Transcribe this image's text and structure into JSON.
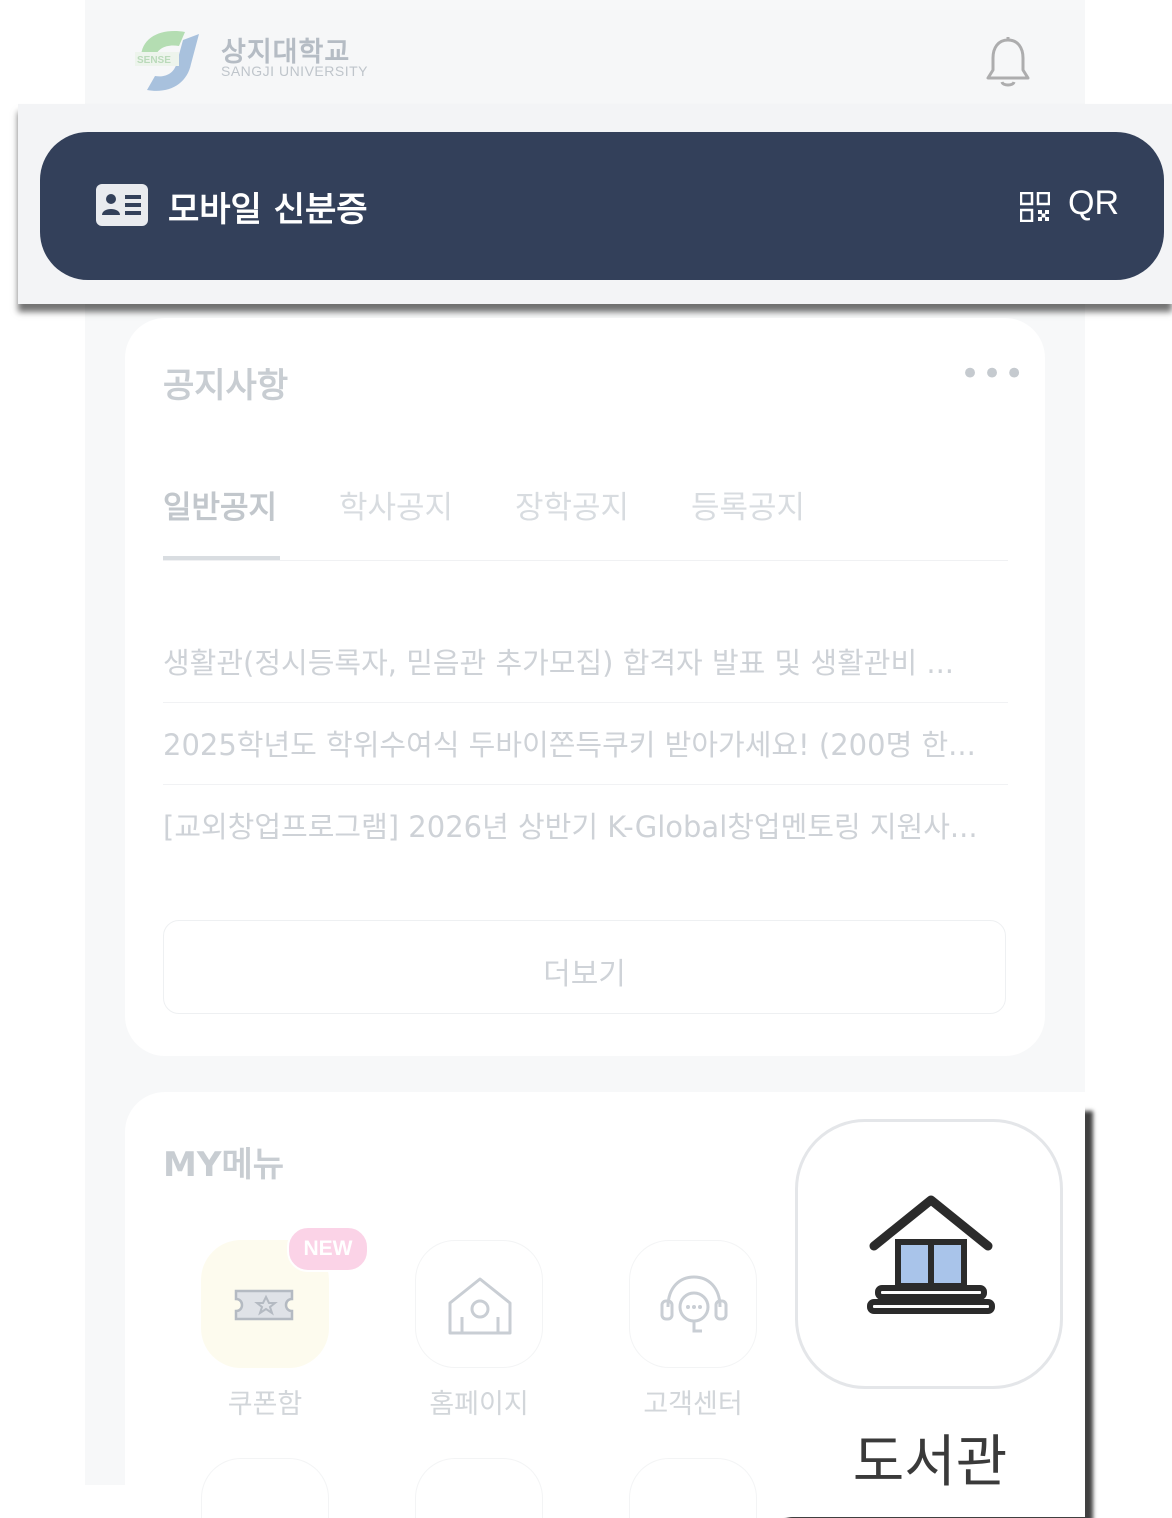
{
  "header": {
    "logo_title": "상지대학교",
    "logo_subtitle": "SANGJI UNIVERSITY",
    "logo_mark_text": "SENSE",
    "notification_icon": "bell-icon"
  },
  "id_card": {
    "label": "모바일 신분증",
    "qr_label": "QR",
    "icon": "id-card-icon",
    "qr_icon": "qr-code-icon",
    "background_color": "#33405a"
  },
  "notice": {
    "title": "공지사항",
    "more_icon": "ellipsis-icon",
    "tabs": [
      {
        "label": "일반공지",
        "active": true
      },
      {
        "label": "학사공지",
        "active": false
      },
      {
        "label": "장학공지",
        "active": false
      },
      {
        "label": "등록공지",
        "active": false
      }
    ],
    "items": [
      "생활관(정시등록자, 믿음관 추가모집) 합격자 발표 및 생활관비 ...",
      "2025학년도 학위수여식 두바이쫀득쿠키 받아가세요! (200명 한...",
      "[교외창업프로그램] 2026년 상반기 K-Global창업멘토링 지원사..."
    ],
    "more_button": "더보기"
  },
  "my_menu": {
    "title": "MY메뉴",
    "new_badge": "NEW",
    "items": [
      {
        "label": "쿠폰함",
        "icon": "coupon-icon"
      },
      {
        "label": "홈페이지",
        "icon": "home-icon"
      },
      {
        "label": "고객센터",
        "icon": "headset-icon"
      }
    ]
  },
  "highlight": {
    "label": "도서관",
    "icon": "library-icon"
  }
}
